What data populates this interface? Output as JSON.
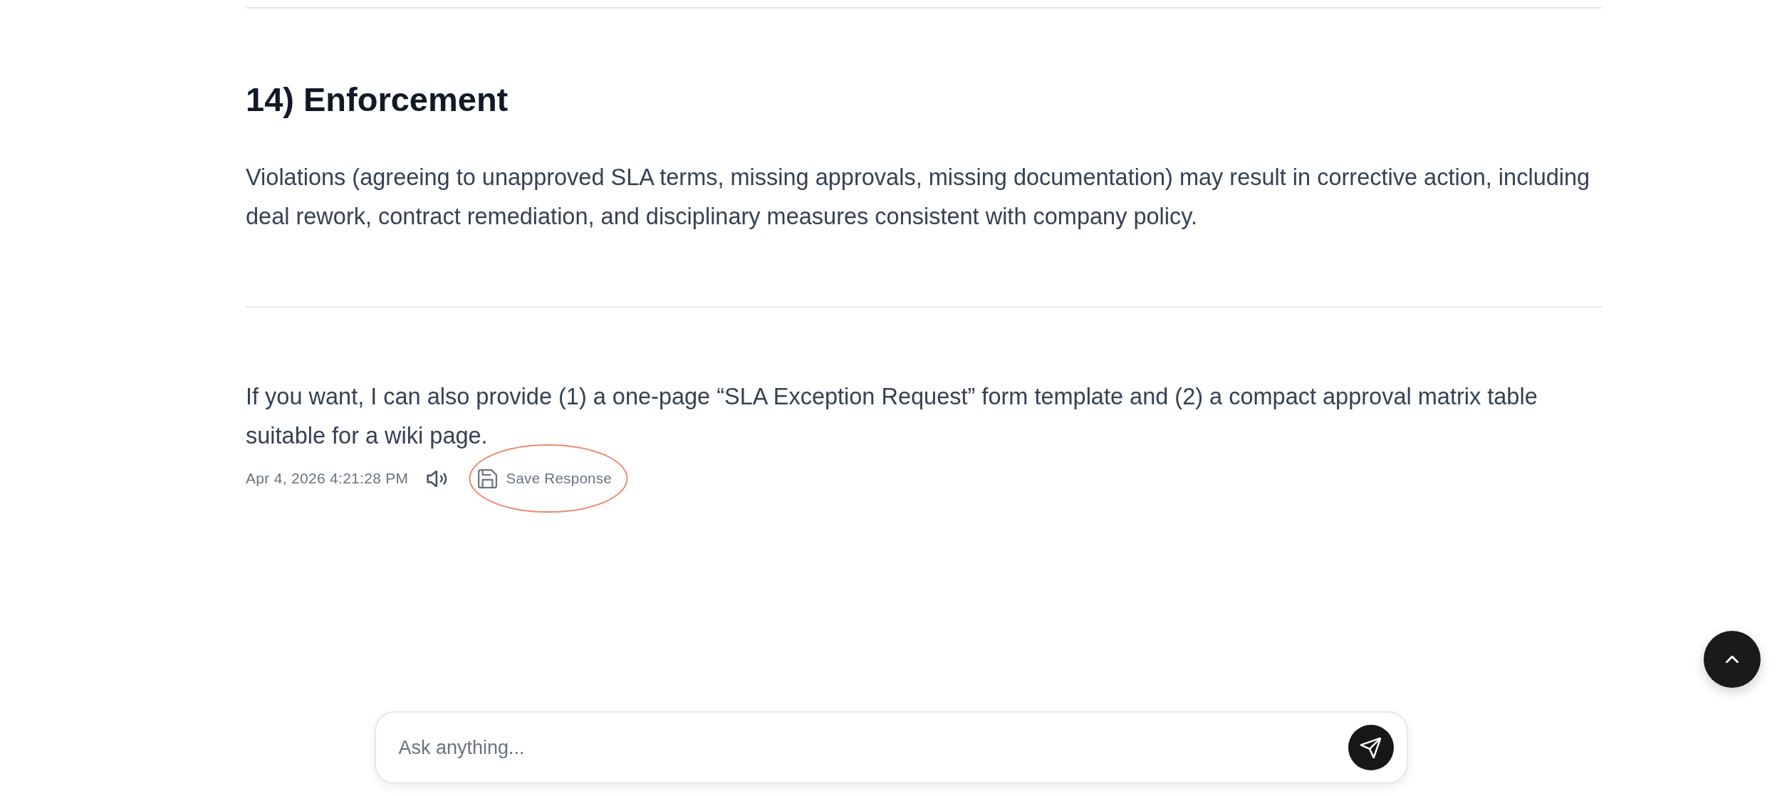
{
  "document": {
    "blocks": [
      {
        "kind": "rule"
      },
      {
        "kind": "heading",
        "text": "14) Enforcement"
      },
      {
        "kind": "paragraph",
        "text": "Violations (agreeing to unapproved SLA terms, missing approvals, missing documentation) may result in corrective action, including deal rework, contract remediation, and disciplinary measures consistent with company policy."
      },
      {
        "kind": "rule"
      },
      {
        "kind": "paragraph",
        "text": "If you want, I can also provide (1) a one-page “SLA Exception Request” form template and (2) a compact approval matrix table suitable for a wiki page."
      }
    ]
  },
  "message_footer": {
    "timestamp": "Apr 4, 2026 4:21:28 PM",
    "save_button": {
      "label": "Save Response",
      "circled": true
    }
  },
  "composer": {
    "placeholder": "Ask anything..."
  }
}
